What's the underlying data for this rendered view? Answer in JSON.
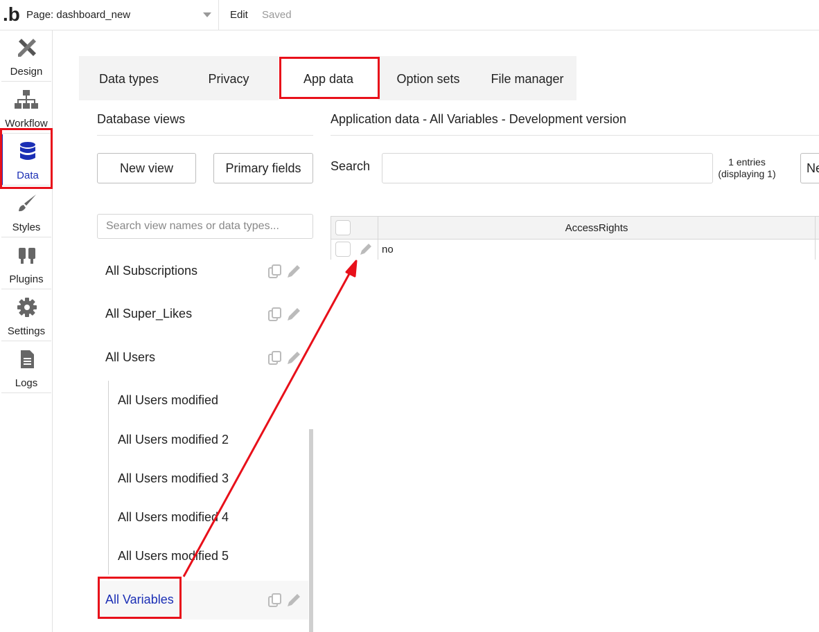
{
  "topbar": {
    "logo": ".b",
    "page_label": "Page: dashboard_new",
    "edit_label": "Edit",
    "saved_label": "Saved"
  },
  "sidebar": {
    "items": [
      {
        "label": "Design",
        "icon": "design-icon"
      },
      {
        "label": "Workflow",
        "icon": "workflow-icon"
      },
      {
        "label": "Data",
        "icon": "database-icon",
        "active": true
      },
      {
        "label": "Styles",
        "icon": "brush-icon"
      },
      {
        "label": "Plugins",
        "icon": "plug-icon"
      },
      {
        "label": "Settings",
        "icon": "gear-icon"
      },
      {
        "label": "Logs",
        "icon": "document-icon"
      }
    ]
  },
  "tabs": [
    {
      "label": "Data types"
    },
    {
      "label": "Privacy"
    },
    {
      "label": "App data",
      "active": true
    },
    {
      "label": "Option sets"
    },
    {
      "label": "File manager"
    }
  ],
  "database_views": {
    "title": "Database views",
    "new_view_label": "New view",
    "primary_fields_label": "Primary fields",
    "search_placeholder": "Search view names or data types...",
    "items": [
      {
        "name": "All Subscriptions"
      },
      {
        "name": "All Super_Likes"
      },
      {
        "name": "All Users"
      }
    ],
    "sub_items": [
      {
        "name": "All Users modified"
      },
      {
        "name": "All Users modified 2"
      },
      {
        "name": "All Users modified 3"
      },
      {
        "name": "All Users modified 4"
      },
      {
        "name": "All Users modified 5"
      }
    ],
    "selected_item": {
      "name": "All Variables"
    }
  },
  "app_data": {
    "title": "Application data - All Variables - Development version",
    "search_label": "Search",
    "entries_line1": "1 entries",
    "entries_line2": "(displaying 1)",
    "new_entry_label": "Ne",
    "columns": [
      "AccessRights"
    ],
    "rows": [
      [
        "no"
      ]
    ]
  },
  "colors": {
    "accent": "#1b2fb5",
    "annotation": "#e8101a",
    "tab_bar_bg": "#f3f3f3"
  }
}
